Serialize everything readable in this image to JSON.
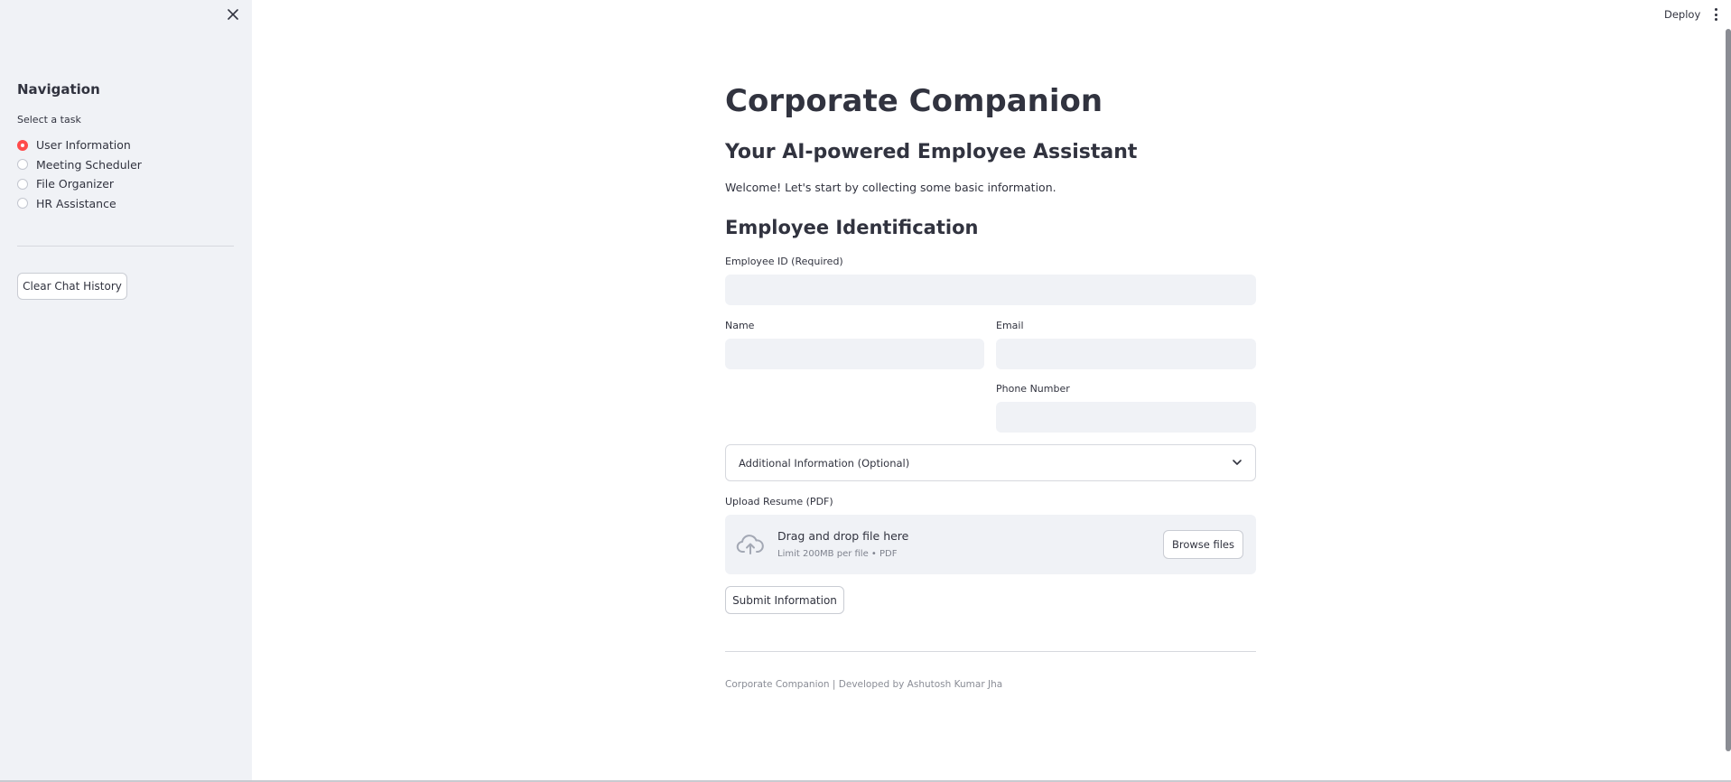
{
  "sidebar": {
    "close_icon": "close-icon",
    "title": "Navigation",
    "radio_label": "Select a task",
    "options": [
      {
        "label": "User Information",
        "selected": true
      },
      {
        "label": "Meeting Scheduler",
        "selected": false
      },
      {
        "label": "File Organizer",
        "selected": false
      },
      {
        "label": "HR Assistance",
        "selected": false
      }
    ],
    "clear_button": "Clear Chat History"
  },
  "toolbar": {
    "deploy_label": "Deploy",
    "menu_icon": "kebab-menu-icon"
  },
  "main": {
    "title": "Corporate Companion",
    "subtitle": "Your AI-powered Employee Assistant",
    "welcome": "Welcome! Let's start by collecting some basic information.",
    "section_title": "Employee Identification",
    "fields": {
      "employee_id": {
        "label": "Employee ID (Required)",
        "value": ""
      },
      "name": {
        "label": "Name",
        "value": ""
      },
      "email": {
        "label": "Email",
        "value": ""
      },
      "phone": {
        "label": "Phone Number",
        "value": ""
      }
    },
    "expander": {
      "label": "Additional Information (Optional)",
      "icon": "chevron-down-icon"
    },
    "upload": {
      "label": "Upload Resume (PDF)",
      "drop_text": "Drag and drop file here",
      "limit_text": "Limit 200MB per file • PDF",
      "browse_button": "Browse files",
      "icon": "cloud-upload-icon"
    },
    "submit_button": "Submit Information",
    "footer": "Corporate Companion | Developed by Ashutosh Kumar Jha"
  },
  "colors": {
    "accent": "#ff4b4b",
    "sidebar_bg": "#f0f2f6",
    "input_bg": "#f0f2f6",
    "text": "#31333f"
  }
}
